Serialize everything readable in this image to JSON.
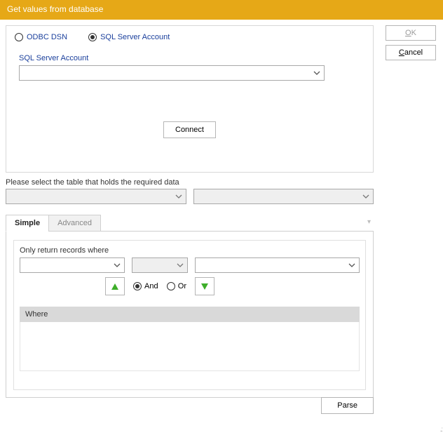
{
  "window": {
    "title": "Get values from database"
  },
  "buttons": {
    "ok": "OK",
    "cancel": "Cancel",
    "connect": "Connect",
    "parse": "Parse"
  },
  "connection": {
    "radio_odbc": "ODBC DSN",
    "radio_sql": "SQL Server Account",
    "selected": "sql",
    "account_label": "SQL Server Account",
    "account_value": "",
    "table_label": "Please select the table that holds the required data",
    "table1": "",
    "table2": ""
  },
  "tabs": {
    "simple": "Simple",
    "advanced": "Advanced",
    "active": "simple"
  },
  "filter": {
    "label": "Only return records where",
    "field": "",
    "op": "",
    "value": "",
    "logic_and": "And",
    "logic_or": "Or",
    "logic_selected": "and",
    "where_header": "Where"
  }
}
